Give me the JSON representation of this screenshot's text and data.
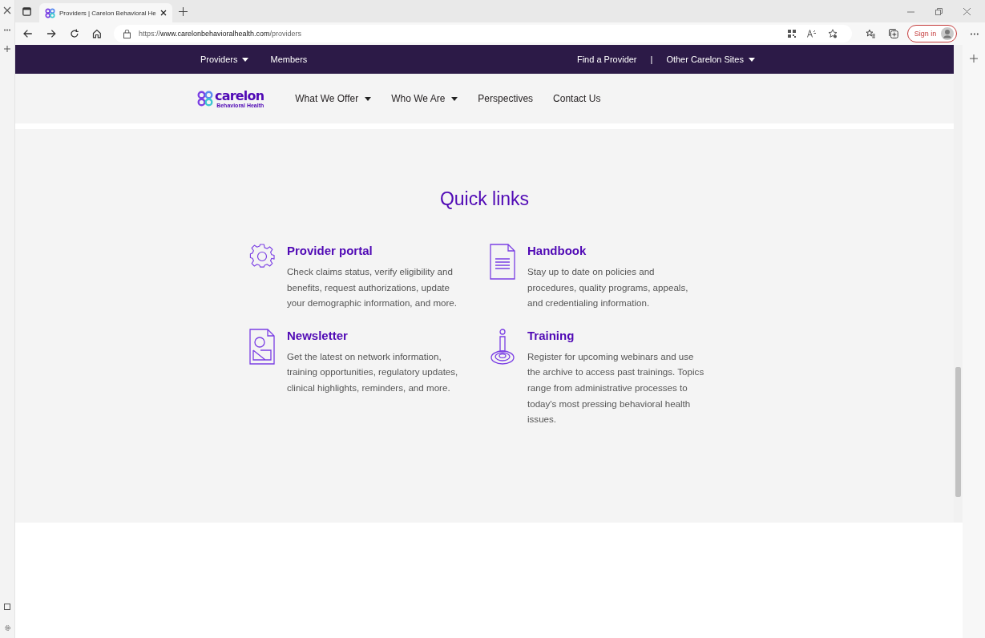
{
  "browser": {
    "tab_title": "Providers | Carelon Behavioral He",
    "url_prefix": "https://",
    "url_host": "www.carelonbehavioralhealth.com",
    "url_path": "/providers",
    "sign_in": "Sign in"
  },
  "utility_nav": {
    "left": [
      {
        "label": "Providers",
        "dropdown": true
      },
      {
        "label": "Members",
        "dropdown": false
      }
    ],
    "right": [
      {
        "label": "Find a Provider",
        "dropdown": false
      },
      {
        "label": "Other Carelon Sites",
        "dropdown": true
      }
    ],
    "separator": "|"
  },
  "logo": {
    "name": "carelon",
    "tagline": "Behavioral Health"
  },
  "main_nav": [
    {
      "label": "What We Offer",
      "dropdown": true
    },
    {
      "label": "Who We Are",
      "dropdown": true
    },
    {
      "label": "Perspectives",
      "dropdown": false
    },
    {
      "label": "Contact Us",
      "dropdown": false
    }
  ],
  "quick_links": {
    "title": "Quick links",
    "items": [
      {
        "kind": "gear",
        "title": "Provider portal",
        "text": "Check claims status, verify eligibility and benefits, request authorizations, update your demographic information, and more."
      },
      {
        "kind": "document",
        "title": "Handbook",
        "text": "Stay up to date on policies and procedures, quality programs, appeals, and credentialing information."
      },
      {
        "kind": "newsletter",
        "title": "Newsletter",
        "text": "Get the latest on network information, training opportunities, regulatory updates, clinical highlights, reminders, and more."
      },
      {
        "kind": "person",
        "title": "Training",
        "text": "Register for upcoming webinars and use the archive to access past trainings. Topics range from administrative processes to today's most pressing behavioral health issues."
      }
    ]
  }
}
